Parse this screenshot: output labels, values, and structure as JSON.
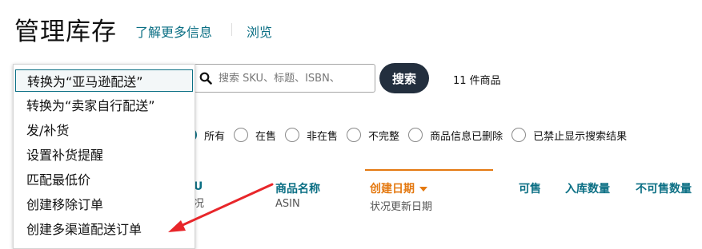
{
  "header": {
    "title": "管理库存",
    "learn_more": "了解更多信息",
    "browse": "浏览"
  },
  "search": {
    "placeholder": "搜索 SKU、标题、ISBN、",
    "button": "搜索",
    "count": "11 件商品"
  },
  "filters": [
    {
      "label": "所有",
      "checked": true
    },
    {
      "label": "在售",
      "checked": false
    },
    {
      "label": "非在售",
      "checked": false
    },
    {
      "label": "不完整",
      "checked": false
    },
    {
      "label": "商品信息已删除",
      "checked": false
    },
    {
      "label": "已禁止显示搜索结果",
      "checked": false
    }
  ],
  "columns": {
    "sku": {
      "line1": "U",
      "line2": "况"
    },
    "name": {
      "line1": "商品名称",
      "line2": "ASIN"
    },
    "date": {
      "line1": "创建日期",
      "line2": "状况更新日期"
    },
    "available": {
      "line1": "可售"
    },
    "inbound": {
      "line1": "入库数量"
    },
    "unfulfillable": {
      "line1": "不可售数量"
    }
  },
  "dropdown": {
    "items": [
      "转换为“亚马逊配送”",
      "转换为“卖家自行配送”",
      "发/补货",
      "设置补货提醒",
      "匹配最低价",
      "创建移除订单",
      "创建多渠道配送订单"
    ]
  },
  "colors": {
    "link": "#0b6f84",
    "accent_orange": "#e47911",
    "button_dark": "#232f3e",
    "annotation_arrow": "#e8262a"
  }
}
